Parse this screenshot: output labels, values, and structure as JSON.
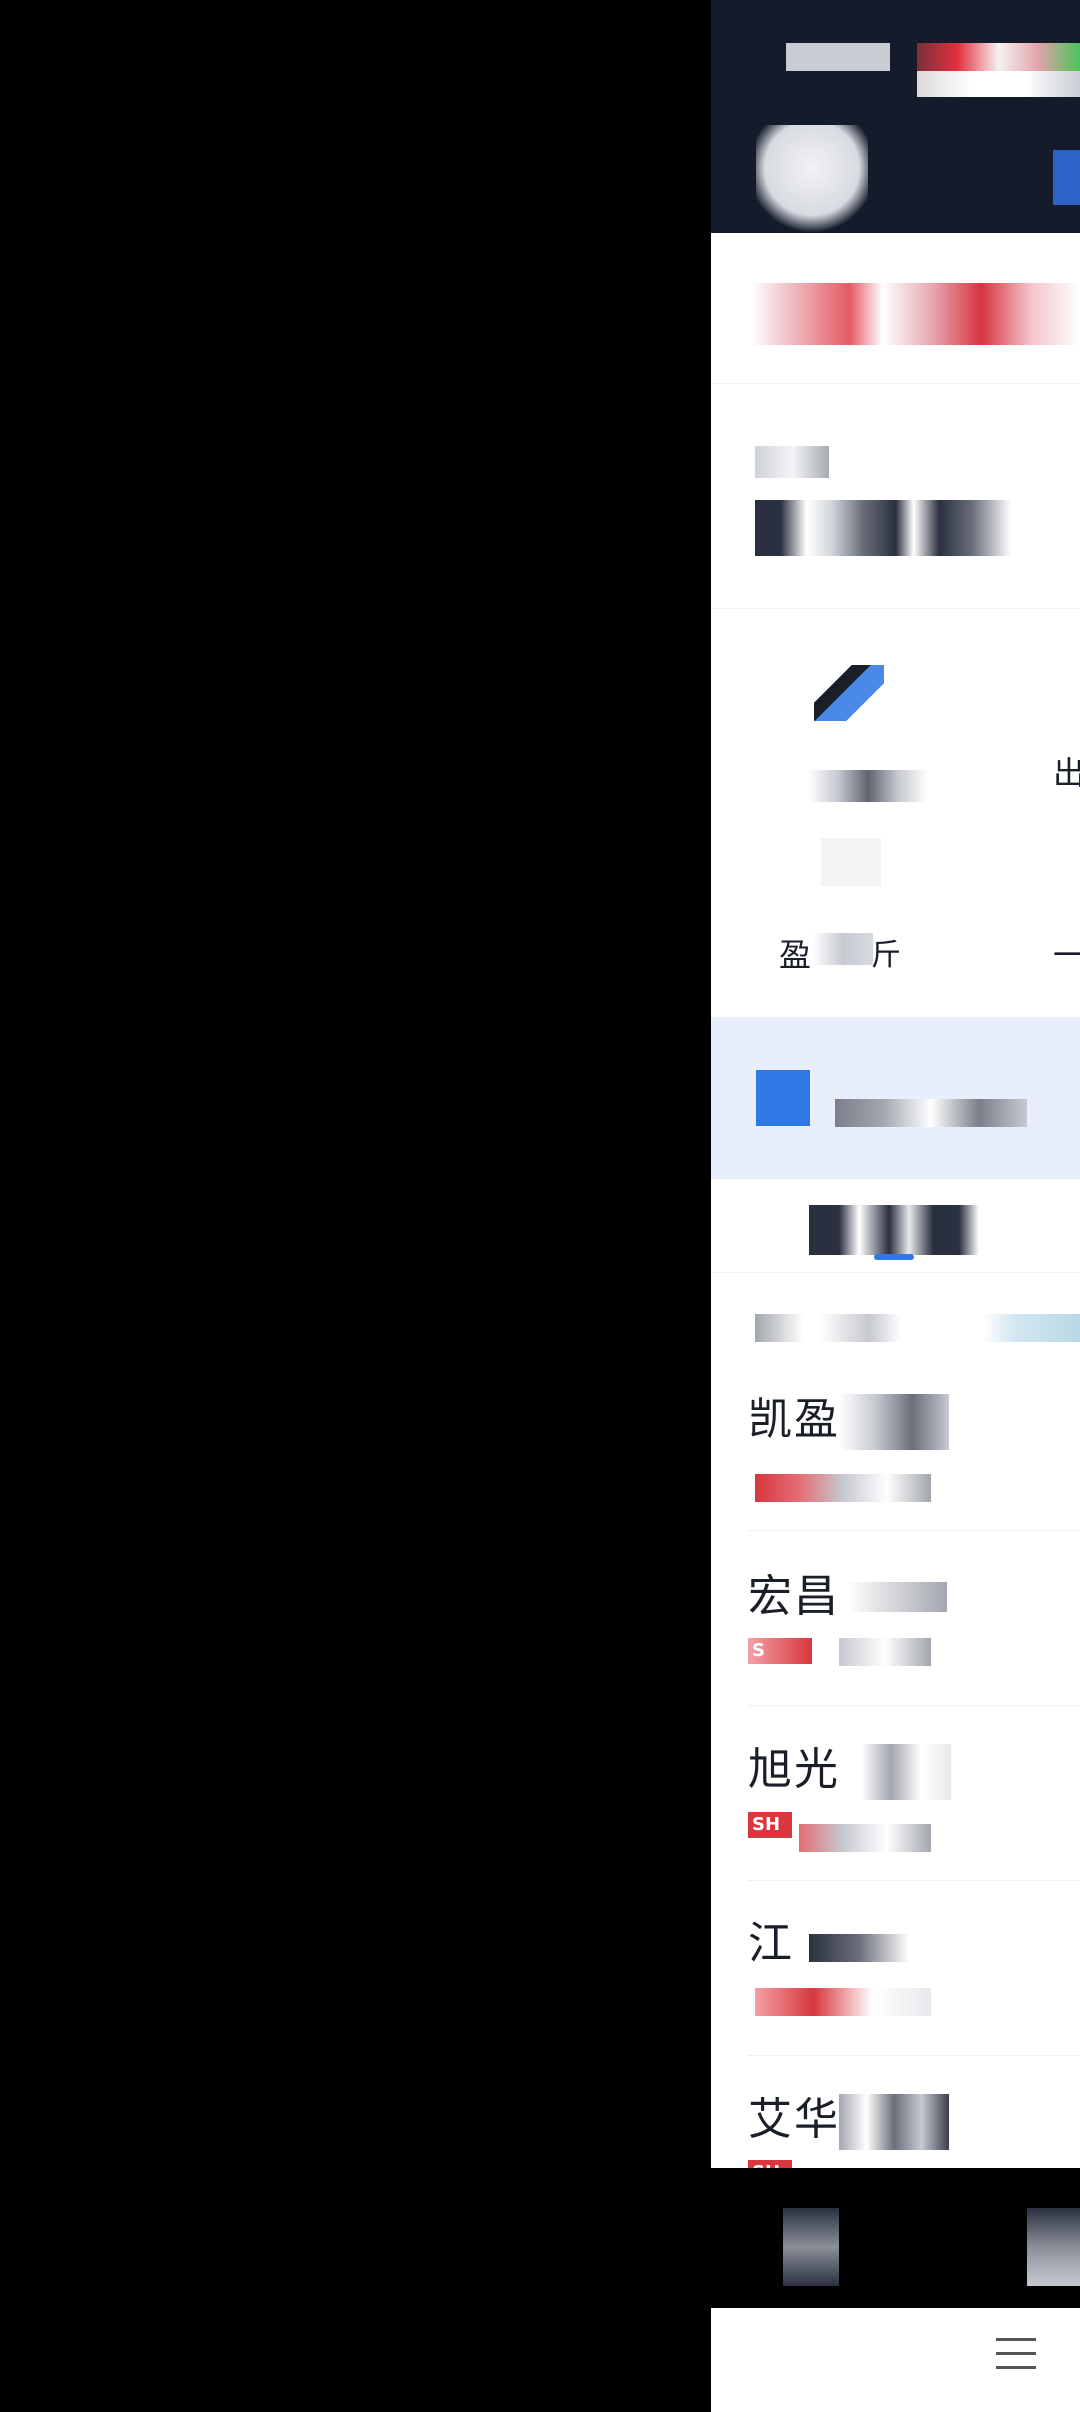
{
  "overlay": {
    "visible": true
  },
  "top_section": {
    "right_edge_label": "出",
    "item_label": "盈",
    "item_label_suffix": "斤",
    "right_dash": "一"
  },
  "stock_list": {
    "items": [
      {
        "name": "凯盈",
        "badge": ""
      },
      {
        "name": "宏昌",
        "badge": "S"
      },
      {
        "name": "旭光",
        "badge": "SH"
      },
      {
        "name": "江",
        "badge": ""
      },
      {
        "name": "艾华",
        "badge": "SH"
      }
    ]
  },
  "bottom_nav": {
    "menu_icon": "hamburger-menu-icon"
  }
}
